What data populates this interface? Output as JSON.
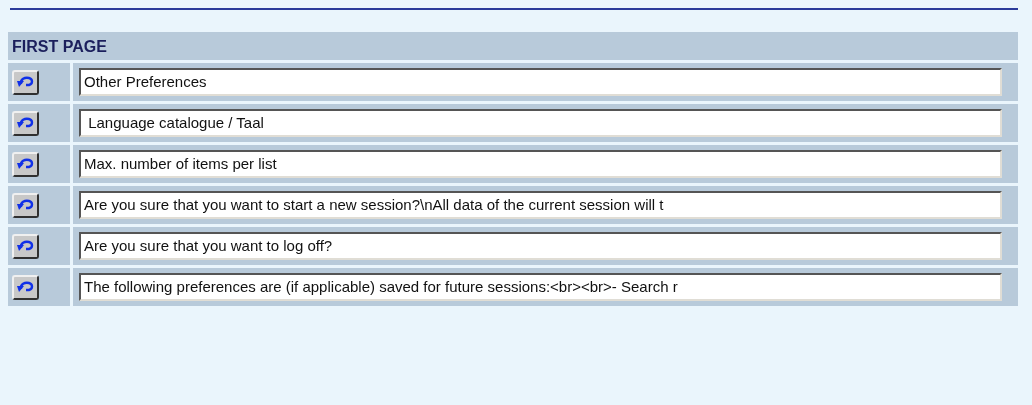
{
  "section": {
    "title": "FIRST PAGE"
  },
  "rows": [
    {
      "value": "Other Preferences"
    },
    {
      "value": " Language catalogue / Taal"
    },
    {
      "value": "Max. number of items per list"
    },
    {
      "value": "Are you sure that you want to start a new session?\\nAll data of the current session will t"
    },
    {
      "value": "Are you sure that you want to log off?"
    },
    {
      "value": "The following preferences are (if applicable) saved for future sessions:<br><br>- Search r"
    }
  ]
}
